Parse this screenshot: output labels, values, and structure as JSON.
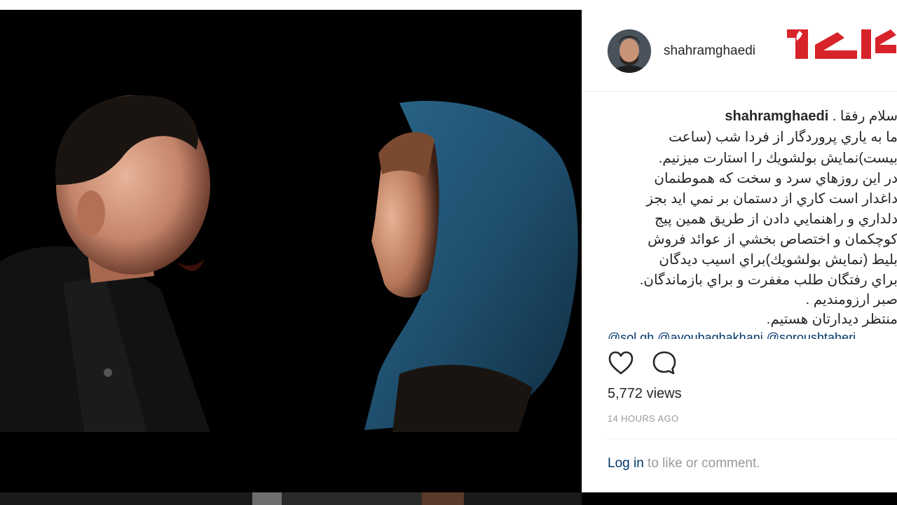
{
  "post": {
    "username": "shahramghaedi",
    "caption_opening": "سلام رفقا .",
    "caption_lines": [
      "ما به ياري پروردگار از فردا شب (ساعت",
      "بيست)نمايش بولشويك را استارت ميزنيم.",
      "در اين روزهاي سرد و سخت كه هموطنمان",
      "داغدار است كاري از دستمان بر نمي ايد بجز",
      "دلداري و راهنمايي دادن از طريق همين پيج",
      "كوچكمان و اختصاص بخشي از عوائد فروش",
      "بليط (نمايش بولشويك)براي اسيب ديدگان",
      "براي رفتگان طلب مغفرت و براي بازماندگان.",
      "صبر ارزومنديم .",
      "منتظر ديدارتان هستيم."
    ],
    "mentions": [
      "@sol.gh",
      "@ayoubaghakhani",
      "@soroushtaheri"
    ],
    "views": "5,772 views",
    "time_ago": "14 HOURS AGO",
    "login_link": "Log in",
    "login_rest": " to like or comment."
  },
  "icons": {
    "like": "heart-icon",
    "comment": "comment-icon",
    "logo": "rokna-logo"
  },
  "colors": {
    "text": "#262626",
    "link": "#003569",
    "muted": "#999999",
    "logo_red": "#d8232a",
    "scarf_blue": "#1f4f6e"
  }
}
